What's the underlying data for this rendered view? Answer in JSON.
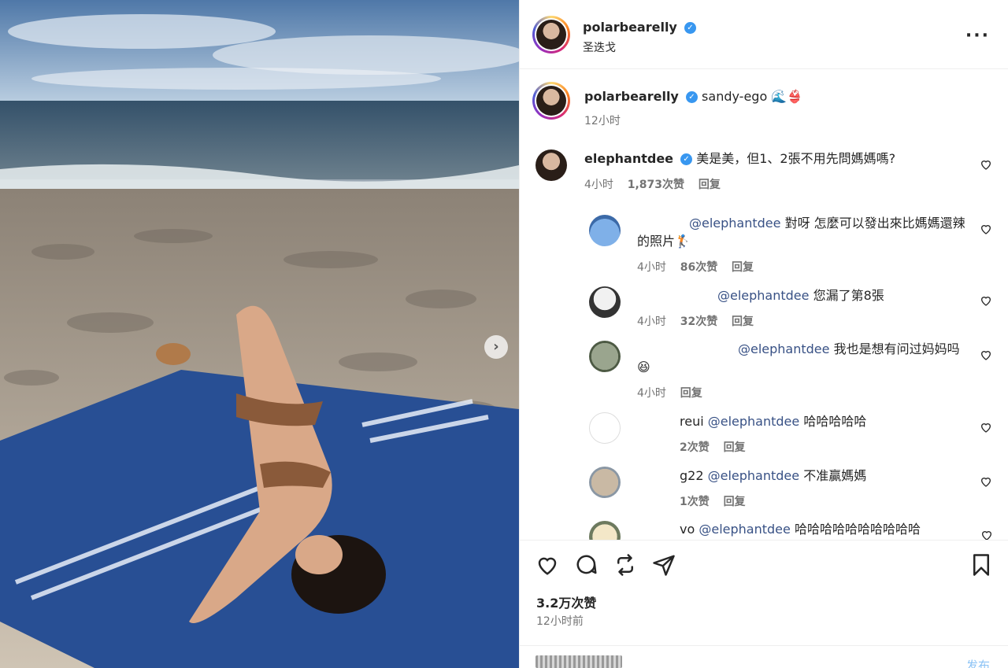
{
  "header": {
    "username": "polarbearelly",
    "location": "圣迭戈",
    "more_icon": "more-horizontal-icon"
  },
  "caption": {
    "username": "polarbearelly",
    "text": "sandy-ego 🌊👙",
    "time": "12小时"
  },
  "comments": [
    {
      "username": "elephantdee",
      "text": "美是美，但1、2張不用先問媽媽嗎?",
      "time": "4小时",
      "likes": "1,873次赞",
      "reply": "回复"
    },
    {
      "username": "",
      "mention": "@elephantdee",
      "text": " 對呀 怎麼可以發出來比媽媽還辣的照片🏌",
      "time": "4小时",
      "likes": "86次赞",
      "reply": "回复"
    },
    {
      "username": "",
      "mention": "@elephantdee",
      "text": " 您漏了第8張",
      "time": "4小时",
      "likes": "32次赞",
      "reply": "回复"
    },
    {
      "username": "",
      "mention": "@elephantdee",
      "text": " 我也是想有问过妈妈吗😆",
      "time": "4小时",
      "likes": "",
      "reply": "回复"
    },
    {
      "username": "reui",
      "mention": "@elephantdee",
      "text": " 哈哈哈哈哈",
      "time": "",
      "likes": "2次赞",
      "reply": "回复"
    },
    {
      "username": "g22",
      "mention": "@elephantdee",
      "text": " 不准贏媽媽",
      "time": "",
      "likes": "1次赞",
      "reply": "回复"
    },
    {
      "username": "vo",
      "mention": "@elephantdee",
      "text": " 哈哈哈哈哈哈哈哈哈哈",
      "time": "",
      "likes": "",
      "reply": ""
    }
  ],
  "actions": {
    "likes": "3.2万次赞",
    "posted": "12小时前",
    "post_button": "发布"
  },
  "colors": {
    "verified": "#3897f0",
    "mention": "#385185",
    "post_button": "#8cc3f5"
  }
}
